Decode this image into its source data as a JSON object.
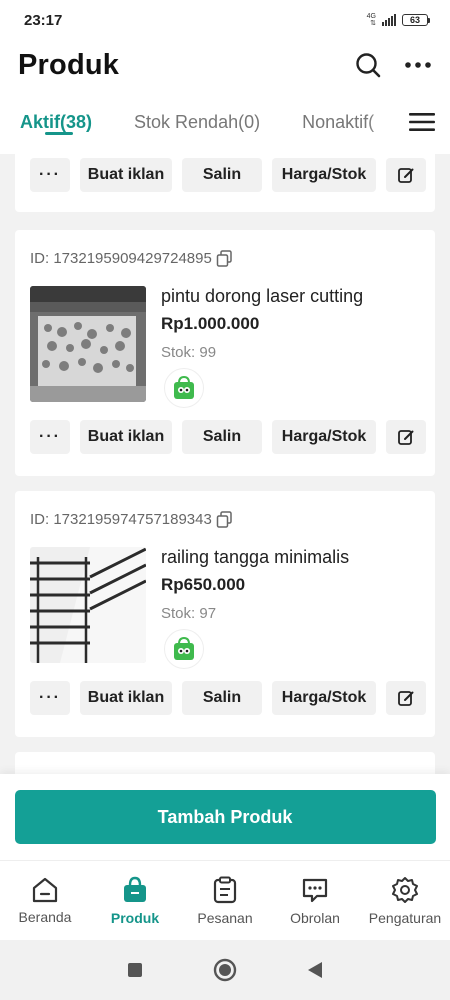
{
  "status_bar": {
    "time": "23:17",
    "network": "4G",
    "battery": "63"
  },
  "header": {
    "title": "Produk"
  },
  "tabs": [
    {
      "label": "Aktif(38)",
      "active": true
    },
    {
      "label": "Stok Rendah(0)",
      "active": false
    },
    {
      "label": "Nonaktif(",
      "active": false
    }
  ],
  "actions": {
    "more": "···",
    "ad": "Buat iklan",
    "copy": "Salin",
    "price_stock": "Harga/Stok"
  },
  "products": [
    {
      "id": "ID: 1732195909429724895",
      "name": "pintu dorong laser cutting",
      "price": "Rp1.000.000",
      "stock": "Stok: 99"
    },
    {
      "id": "ID: 1732195974757189343",
      "name": "railing tangga minimalis",
      "price": "Rp650.000",
      "stock": "Stok: 97"
    }
  ],
  "cta": {
    "label": "Tambah Produk"
  },
  "bottom_nav": [
    {
      "label": "Beranda",
      "icon": "home-icon",
      "active": false
    },
    {
      "label": "Produk",
      "icon": "bag-icon",
      "active": true
    },
    {
      "label": "Pesanan",
      "icon": "clipboard-icon",
      "active": false
    },
    {
      "label": "Obrolan",
      "icon": "chat-icon",
      "active": false
    },
    {
      "label": "Pengaturan",
      "icon": "gear-icon",
      "active": false
    }
  ],
  "colors": {
    "accent": "#14a096",
    "text": "#222222",
    "muted": "#888888"
  }
}
